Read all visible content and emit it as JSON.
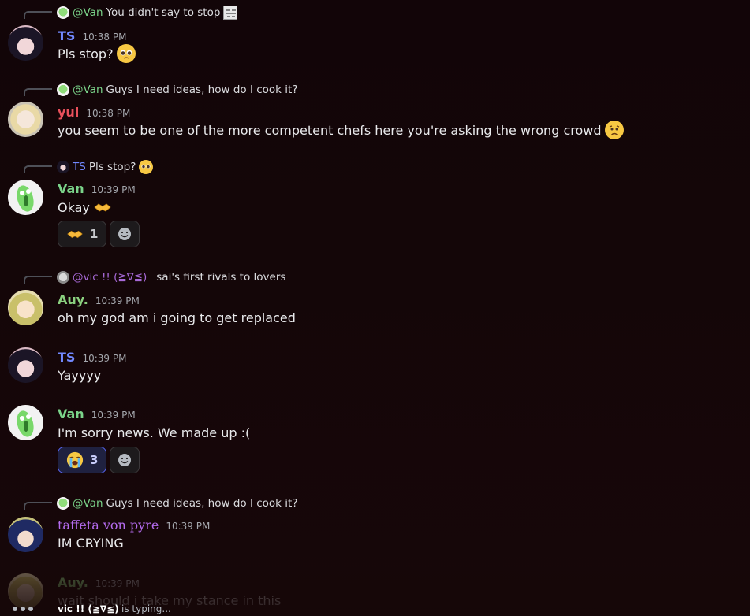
{
  "colors": {
    "background": "#150708",
    "author_ts": "#7289ff",
    "author_yul": "#e8505b",
    "author_van": "#7bd48a",
    "author_auy": "#8bd07f",
    "author_taffeta": "#b56cf0",
    "author_vic": "#a86ad8",
    "reaction_selected_border": "#5865f2"
  },
  "messages": [
    {
      "reply": {
        "author": "@Van",
        "text": "You didn't say to stop",
        "icon": "meme-sticker-icon"
      },
      "author": "TS",
      "time": "10:38 PM",
      "text": "Pls stop?",
      "emoji": "pleading-face-emoji"
    },
    {
      "reply": {
        "author": "@Van",
        "text": "Guys I need ideas, how do I cook it?"
      },
      "author": "yul",
      "time": "10:38 PM",
      "text": "you seem to be one of the more competent chefs here you're asking the wrong crowd",
      "emoji": "worried-face-emoji"
    },
    {
      "reply": {
        "author": "TS",
        "text": "Pls stop?",
        "emoji": "pleading-face-emoji"
      },
      "author": "Van",
      "time": "10:39 PM",
      "text": "Okay",
      "emoji": "handshake-emoji",
      "reactions": [
        {
          "emoji": "handshake-emoji",
          "count": "1"
        }
      ]
    },
    {
      "reply": {
        "author": "@vic !!  (≧∇≦)",
        "text": "sai's first rivals to lovers"
      },
      "author": "Auy.",
      "time": "10:39 PM",
      "text": "oh my god am i going to get replaced"
    },
    {
      "author": "TS",
      "time": "10:39 PM",
      "text": "Yayyyy"
    },
    {
      "author": "Van",
      "time": "10:39 PM",
      "text": "I'm sorry news. We made up :(",
      "reactions": [
        {
          "emoji": "loudly-crying-face-emoji",
          "count": "3",
          "selected": true
        }
      ]
    },
    {
      "reply": {
        "author": "@Van",
        "text": "Guys I need ideas, how do I cook it?"
      },
      "author": "taffeta von pyre",
      "time": "10:39 PM",
      "text": "IM CRYING"
    },
    {
      "author": "Auy.",
      "time": "10:39 PM",
      "text": "wait should i take my stance in this"
    }
  ],
  "typing": {
    "who": "vic !!  (≧∇≦)",
    "what": "is typing..."
  }
}
